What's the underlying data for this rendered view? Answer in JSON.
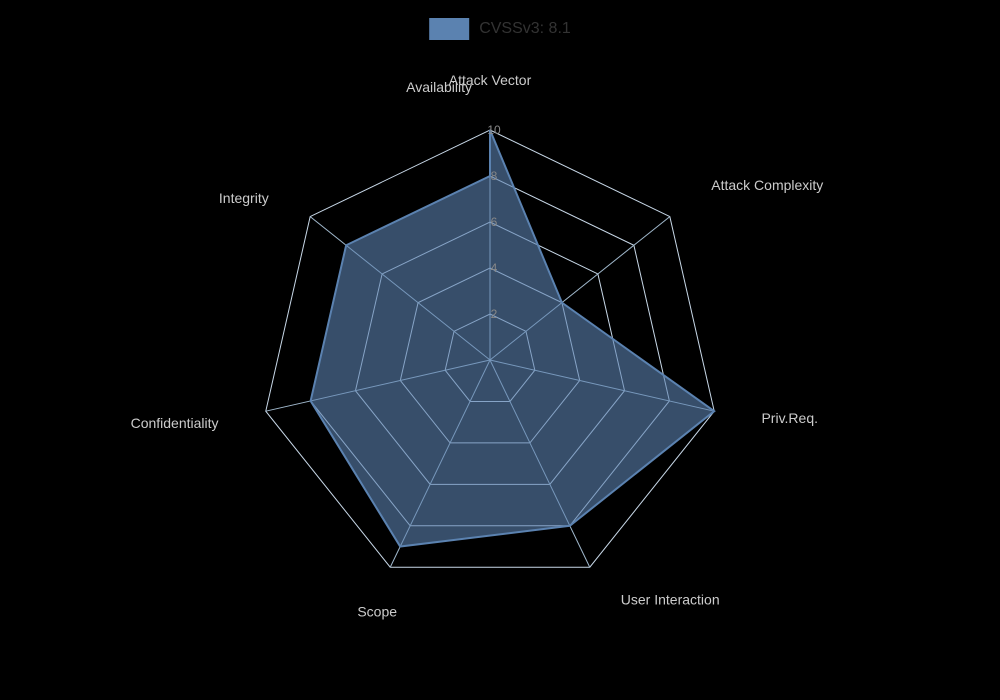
{
  "chart": {
    "title": "CVSSv3: 8.1",
    "axes": [
      {
        "name": "Attack Vector",
        "value": 10,
        "angle": -90
      },
      {
        "name": "Attack Complexity",
        "value": 4,
        "angle": -38.57
      },
      {
        "name": "Priv.Req.",
        "value": 10,
        "angle": 12.86
      },
      {
        "name": "User Interaction",
        "value": 8,
        "angle": 64.29
      },
      {
        "name": "Scope",
        "value": 9,
        "angle": 115.71
      },
      {
        "name": "Confidentiality",
        "value": 8,
        "angle": 167.14
      },
      {
        "name": "Integrity",
        "value": 8,
        "angle": 218.57
      },
      {
        "name": "Availability",
        "value": 8,
        "angle": 270
      }
    ],
    "maxValue": 10,
    "levels": [
      2,
      4,
      6,
      8,
      10
    ],
    "colors": {
      "fill": "#5b82b0",
      "fillOpacity": 0.6,
      "stroke": "#5b82b0",
      "gridStroke": "#a0b8cc",
      "gridStrokeLight": "#c8d8e8"
    }
  }
}
